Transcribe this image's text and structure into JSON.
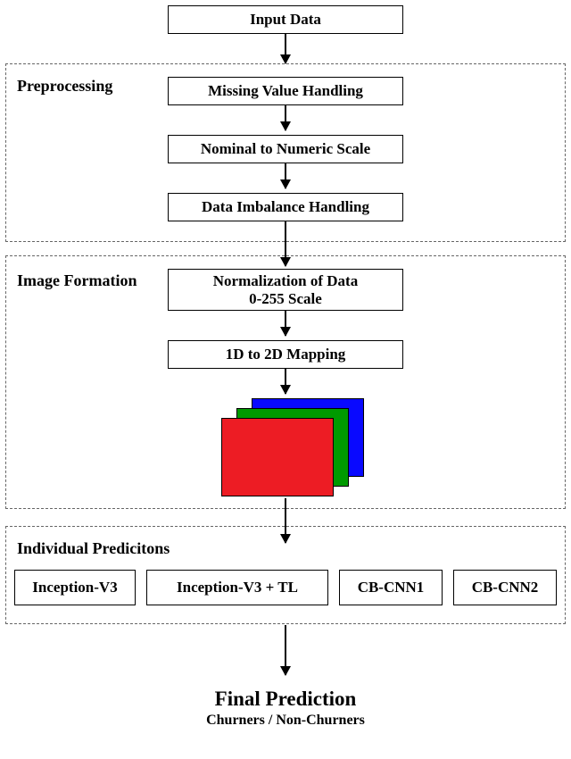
{
  "input_box": "Input Data",
  "sections": {
    "preprocessing": {
      "label": "Preprocessing",
      "steps": [
        "Missing Value Handling",
        "Nominal to Numeric Scale",
        "Data Imbalance Handling"
      ]
    },
    "image_formation": {
      "label": "Image Formation",
      "steps": [
        "Normalization of Data\n0-255 Scale",
        "1D to 2D Mapping"
      ]
    },
    "individual_predictions": {
      "label": "Individual Predicitons",
      "models": [
        "Inception-V3",
        "Inception-V3 + TL",
        "CB-CNN1",
        "CB-CNN2"
      ]
    }
  },
  "image_stack_colors": {
    "back": "#0909ff",
    "mid": "#009a00",
    "front": "#ed1c24"
  },
  "final": {
    "title": "Final Prediction",
    "subtitle": "Churners / Non-Churners"
  }
}
